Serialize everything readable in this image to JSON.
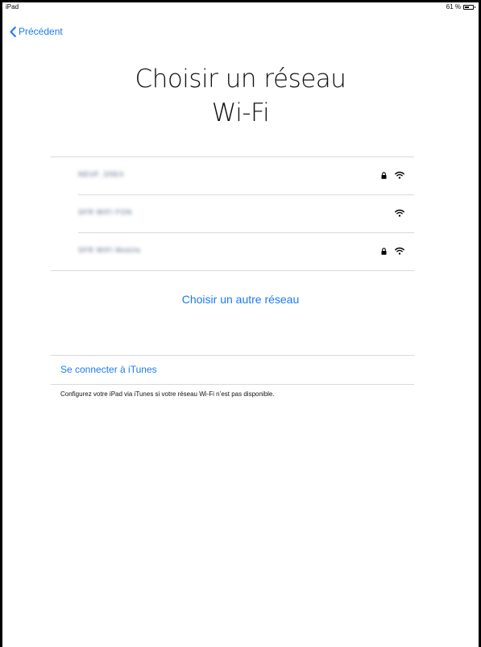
{
  "status_bar": {
    "device": "iPad",
    "battery_text": "61 %",
    "battery_level": 0.61
  },
  "nav": {
    "back_label": "Précédent"
  },
  "title": {
    "line1": "Choisir un réseau",
    "line2": "Wi-Fi"
  },
  "networks": [
    {
      "name": "NEUF_D5E4",
      "secured": true,
      "icon": "wifi-icon"
    },
    {
      "name": "SFR WiFi FON",
      "secured": false,
      "icon": "wifi-icon"
    },
    {
      "name": "SFR WiFi Mobile",
      "secured": true,
      "icon": "wifi-icon"
    }
  ],
  "other_network_label": "Choisir un autre réseau",
  "itunes": {
    "link_label": "Se connecter à iTunes",
    "footnote": "Configurez votre iPad via iTunes si votre réseau Wi-Fi n’est pas disponible."
  },
  "colors": {
    "accent": "#1a7bf5",
    "separator": "#d9d9dc"
  }
}
